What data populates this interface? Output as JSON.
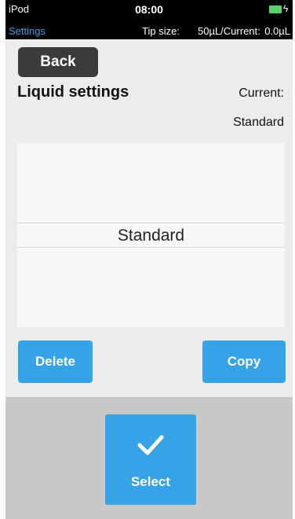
{
  "status_bar": {
    "carrier": "iPod",
    "time": "08:00",
    "screen": "Settings",
    "tip_label": "Tip size:",
    "tip_value": "50µL/Current:",
    "current_volume": "0.0µL"
  },
  "header": {
    "back_label": "Back",
    "title": "Liquid settings",
    "current_label": "Current:",
    "current_value": "Standard"
  },
  "picker": {
    "items": [
      "Standard"
    ],
    "selected": "Standard"
  },
  "actions": {
    "delete_label": "Delete",
    "copy_label": "Copy",
    "select_label": "Select"
  },
  "colors": {
    "accent": "#36a3e6",
    "back_button": "#3b3b3b",
    "battery": "#58d26b"
  }
}
